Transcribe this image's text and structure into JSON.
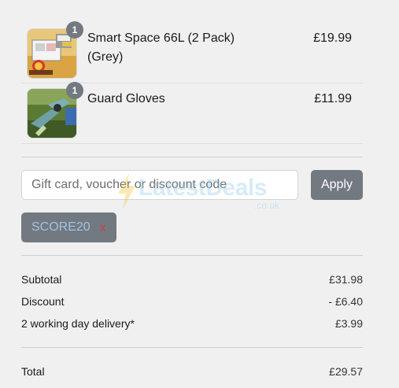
{
  "cart": {
    "items": [
      {
        "name": "Smart Space 66L (2 Pack) (Grey)",
        "price": "£19.99",
        "quantity": "1",
        "image_icon": "storage-box-icon"
      },
      {
        "name": "Guard Gloves",
        "price": "£11.99",
        "quantity": "1",
        "image_icon": "gloves-icon"
      }
    ]
  },
  "discount": {
    "placeholder": "Gift card, voucher or discount code",
    "value": "",
    "apply_label": "Apply",
    "applied_code": "SCORE20",
    "remove_label": "x"
  },
  "watermark": {
    "text": "LatestDeals",
    "sub": ".co.uk"
  },
  "summary": {
    "subtotal_label": "Subtotal",
    "subtotal_value": "£31.98",
    "discount_label": "Discount",
    "discount_value": "- £6.40",
    "delivery_label": "2 working day delivery*",
    "delivery_value": "£3.99",
    "total_label": "Total",
    "total_value": "£29.57"
  },
  "colors": {
    "background": "#f0f0f0",
    "button": "#737980",
    "code_text": "#9ec4e6",
    "remove": "#d43b3b"
  }
}
